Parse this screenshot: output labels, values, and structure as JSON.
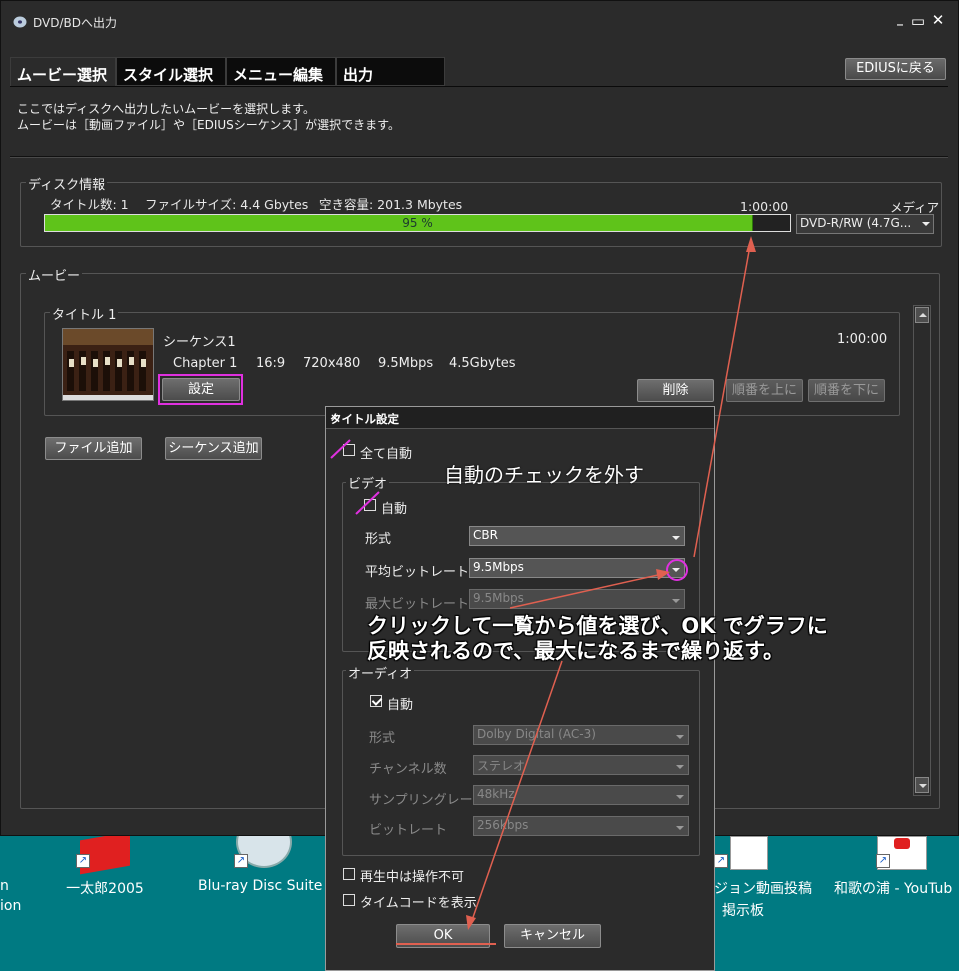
{
  "window": {
    "title": "DVD/BDへ出力",
    "back_button": "EDIUSに戻る"
  },
  "tabs": [
    "ムービー選択",
    "スタイル選択",
    "メニュー編集",
    "出力"
  ],
  "description": [
    "ここではディスクへ出力したいムービーを選択します。",
    "ムービーは［動画ファイル］や［EDIUSシーケンス］が選択できます。"
  ],
  "disc_info": {
    "label": "ディスク情報",
    "title_count": "タイトル数: 1",
    "file_size": "ファイルサイズ: 4.4 Gbytes",
    "free_space": "空き容量: 201.3 Mbytes",
    "duration": "1:00:00",
    "usage_percent": 95,
    "usage_text": "95 %",
    "media_label": "メディア",
    "media_value": "DVD-R/RW (4.7G..."
  },
  "movie": {
    "label": "ムービー",
    "title_group": "タイトル 1",
    "sequence_name": "シーケンス1",
    "chapter": "Chapter 1",
    "aspect": "16:9",
    "resolution": "720x480",
    "bitrate": "9.5Mbps",
    "size": "4.5Gbytes",
    "duration": "1:00:00",
    "settings_button": "設定",
    "delete_button": "削除",
    "move_up_button": "順番を上に",
    "move_down_button": "順番を下に",
    "add_file_button": "ファイル追加",
    "add_sequence_button": "シーケンス追加"
  },
  "dialog": {
    "title": "タイトル設定",
    "all_auto": "全て自動",
    "video_group": "ビデオ",
    "video_auto": "自動",
    "format_label": "形式",
    "format_value": "CBR",
    "avg_bitrate_label": "平均ビットレート",
    "avg_bitrate_value": "9.5Mbps",
    "max_bitrate_label": "最大ビットレート",
    "max_bitrate_value": "9.5Mbps",
    "audio_group": "オーディオ",
    "audio_auto": "自動",
    "audio_format_label": "形式",
    "audio_format_value": "Dolby Digital (AC-3)",
    "channels_label": "チャンネル数",
    "channels_value": "ステレオ",
    "sampling_label": "サンプリングレート",
    "sampling_value": "48kHz",
    "audio_bitrate_label": "ビットレート",
    "audio_bitrate_value": "256kbps",
    "no_operation": "再生中は操作不可",
    "show_timecode": "タイムコードを表示",
    "ok": "OK",
    "cancel": "キャンセル"
  },
  "annotations": {
    "uncheck_auto": "自動のチェックを外す",
    "instruction_line1": "クリックして一覧から値を選び、OK でグラフに",
    "instruction_line2": "反映されるので、最大になるまで繰り返す。",
    "highlight_color": "#e030e0",
    "arrow_color": "#e06050"
  },
  "desktop": {
    "icons": [
      "一太郎2005",
      "Blu-ray Disc Suite",
      "ジョン動画投稿",
      "掲示板",
      "和歌の浦 - YouTub"
    ],
    "partial_left": [
      "n",
      "ion"
    ]
  }
}
